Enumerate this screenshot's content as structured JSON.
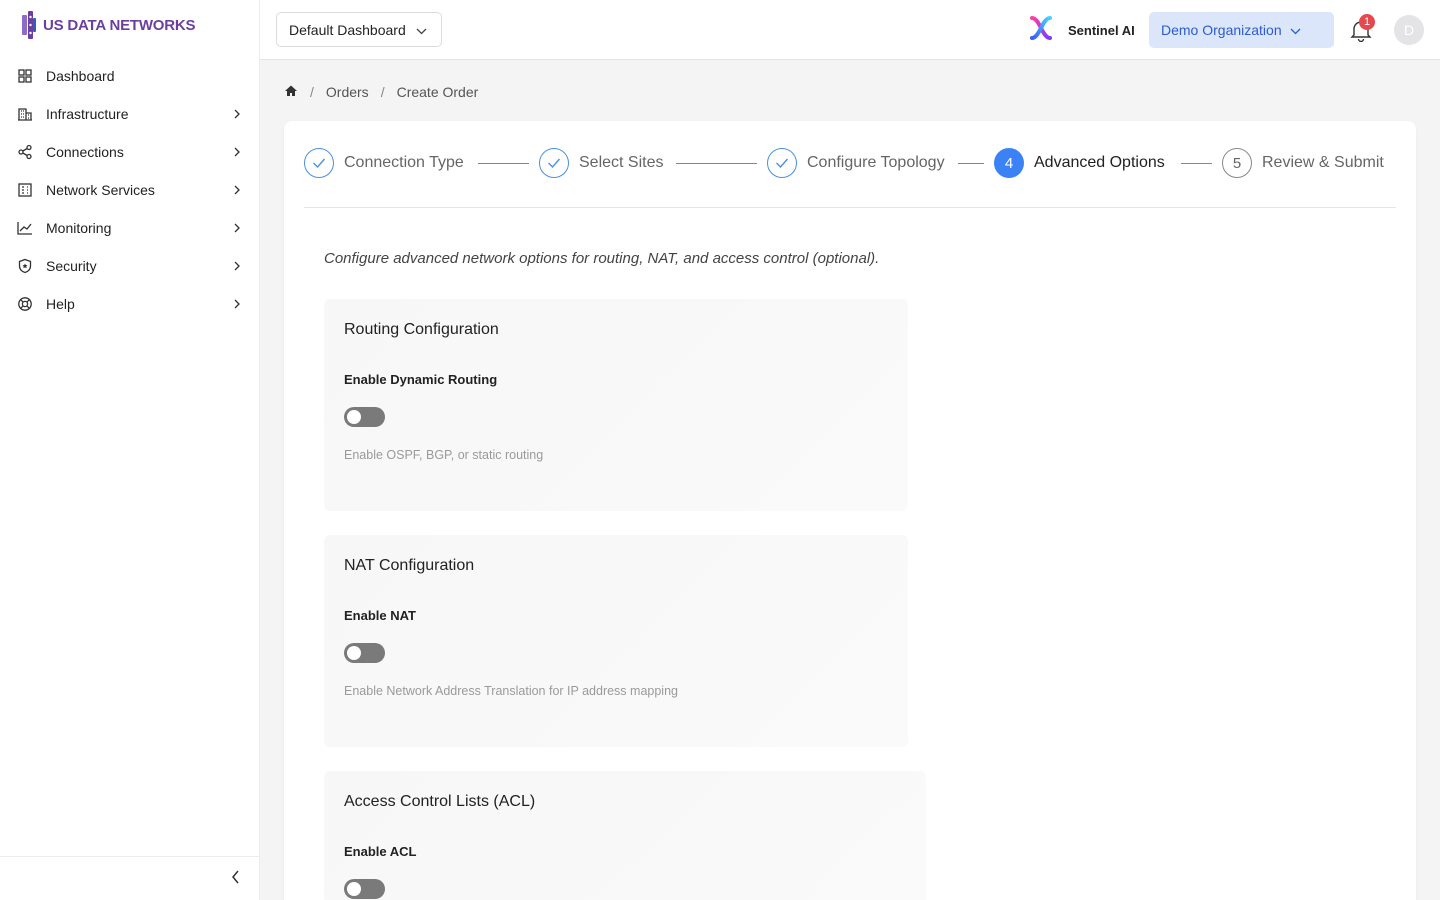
{
  "brand": {
    "name": "US DATA NETWORKS",
    "logo_color": "#6b3fa0"
  },
  "sidebar": {
    "items": [
      {
        "label": "Dashboard",
        "icon": "grid-icon",
        "has_children": false
      },
      {
        "label": "Infrastructure",
        "icon": "building-icon",
        "has_children": true
      },
      {
        "label": "Connections",
        "icon": "share-nodes-icon",
        "has_children": true
      },
      {
        "label": "Network Services",
        "icon": "server-icon",
        "has_children": true
      },
      {
        "label": "Monitoring",
        "icon": "line-chart-icon",
        "has_children": true
      },
      {
        "label": "Security",
        "icon": "shield-icon",
        "has_children": true
      },
      {
        "label": "Help",
        "icon": "lifebuoy-icon",
        "has_children": true
      }
    ],
    "collapse_icon": "chevron-left-icon"
  },
  "header": {
    "dashboard_select": "Default Dashboard",
    "sentinel_label": "Sentinel AI",
    "organization": "Demo Organization",
    "notification_count": "1",
    "avatar_initial": "D",
    "accent": "#2d5bd1",
    "org_bg": "#dbe6fb",
    "badge_color": "#e5484d"
  },
  "breadcrumb": {
    "home_icon": "home-icon",
    "items": [
      "Orders",
      "Create Order"
    ]
  },
  "wizard": {
    "steps": [
      {
        "number": "1",
        "label": "Connection Type",
        "state": "done"
      },
      {
        "number": "2",
        "label": "Select Sites",
        "state": "done"
      },
      {
        "number": "3",
        "label": "Configure Topology",
        "state": "done"
      },
      {
        "number": "4",
        "label": "Advanced Options",
        "state": "active"
      },
      {
        "number": "5",
        "label": "Review & Submit",
        "state": "todo"
      }
    ],
    "active_color": "#3b82f6",
    "intro": "Configure advanced network options for routing, NAT, and access control (optional).",
    "sections": [
      {
        "title": "Routing Configuration",
        "field_label": "Enable Dynamic Routing",
        "enabled": false,
        "help": "Enable OSPF, BGP, or static routing"
      },
      {
        "title": "NAT Configuration",
        "field_label": "Enable NAT",
        "enabled": false,
        "help": "Enable Network Address Translation for IP address mapping"
      },
      {
        "title": "Access Control Lists (ACL)",
        "field_label": "Enable ACL",
        "enabled": false,
        "help": ""
      }
    ]
  }
}
